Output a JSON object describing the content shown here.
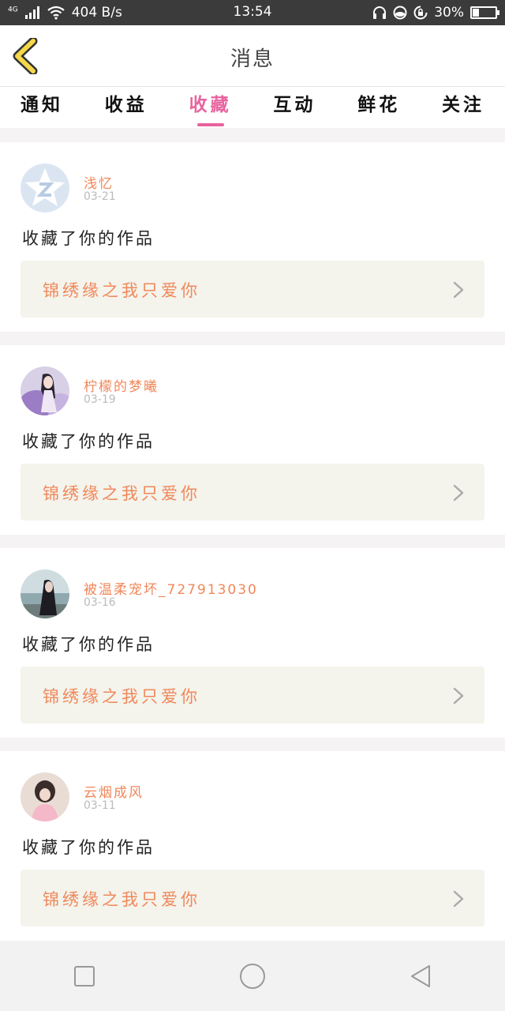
{
  "status_bar": {
    "network": "4G",
    "speed": "404 B/s",
    "time": "13:54",
    "battery": "30%",
    "battery_level": 0.3
  },
  "header": {
    "title": "消息"
  },
  "tabs": [
    {
      "label": "通知",
      "active": false
    },
    {
      "label": "收益",
      "active": false
    },
    {
      "label": "收藏",
      "active": true
    },
    {
      "label": "互动",
      "active": false
    },
    {
      "label": "鲜花",
      "active": false
    },
    {
      "label": "关注",
      "active": false
    }
  ],
  "items": [
    {
      "username": "浅忆",
      "date": "03-21",
      "action": "收藏了你的作品",
      "work_title": "锦绣缘之我只爱你",
      "avatar": "qq-default-avatar"
    },
    {
      "username": "柠檬的梦曦",
      "date": "03-19",
      "action": "收藏了你的作品",
      "work_title": "锦绣缘之我只爱你",
      "avatar": "anime-girl-avatar"
    },
    {
      "username": "被温柔宠坏_727913030",
      "date": "03-16",
      "action": "收藏了你的作品",
      "work_title": "锦绣缘之我只爱你",
      "avatar": "seaside-girl-avatar"
    },
    {
      "username": "云烟成风",
      "date": "03-11",
      "action": "收藏了你的作品",
      "work_title": "锦绣缘之我只爱你",
      "avatar": "pink-girl-avatar"
    }
  ],
  "colors": {
    "accent_pink": "#e8639e",
    "accent_orange": "#f0885a",
    "back_arrow": "#f5d84a"
  }
}
